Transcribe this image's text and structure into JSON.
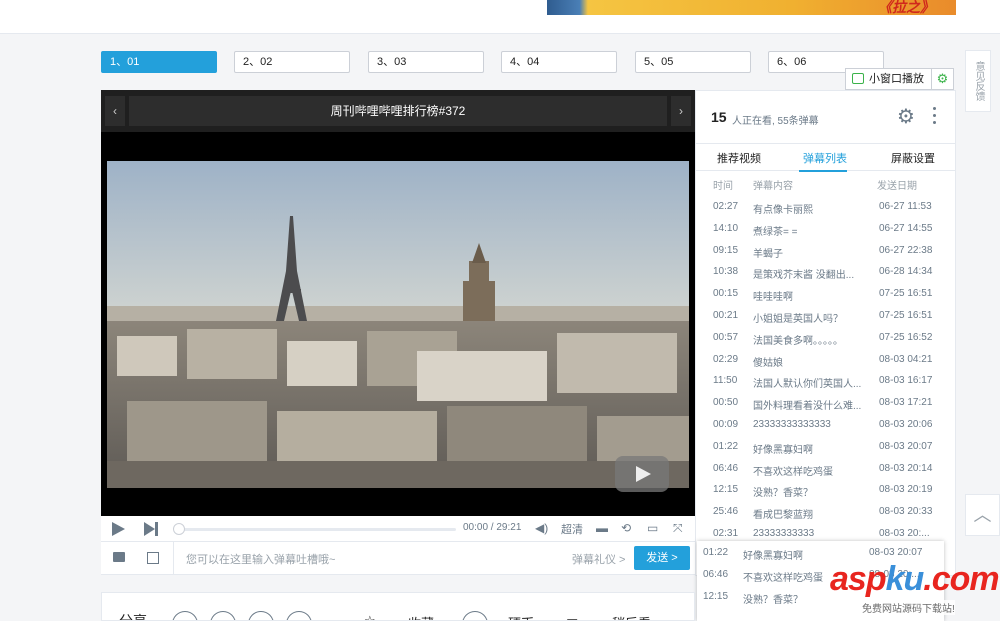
{
  "episodes": [
    "1、01",
    "2、02",
    "3、03",
    "4、04",
    "5、05",
    "6、06"
  ],
  "active_episode_index": 0,
  "feedback_label": "意见反馈",
  "mini_window_label": "小窗口播放",
  "player": {
    "title": "周刊哔哩哔哩排行榜#372",
    "prev_arrow": "‹",
    "next_arrow": "›",
    "current_time": "00:00",
    "total_time": "29:21",
    "quality_label": "超清",
    "progress": 0.0
  },
  "danmaku_input": {
    "placeholder": "您可以在这里输入弹幕吐槽哦~",
    "gift_label": "弹幕礼仪 >",
    "send_label": "发送 >"
  },
  "panel": {
    "viewer_count": "15",
    "watching_text": "人正在看, 55条弹幕",
    "tabs": [
      "推荐视频",
      "弹幕列表",
      "屏蔽设置"
    ],
    "active_tab_index": 1,
    "col_time": "时间",
    "col_content": "弹幕内容",
    "col_date": "发送日期",
    "rows": [
      {
        "time": "02:27",
        "content": "有点像卡丽熙",
        "date": "06-27 11:53"
      },
      {
        "time": "14:10",
        "content": "煮绿茶= =",
        "date": "06-27 14:55"
      },
      {
        "time": "09:15",
        "content": "羊蝎子",
        "date": "06-27 22:38"
      },
      {
        "time": "10:38",
        "content": "是策戏芥末酱 没翻出...",
        "date": "06-28 14:34"
      },
      {
        "time": "00:15",
        "content": "哇哇哇啊",
        "date": "07-25 16:51"
      },
      {
        "time": "00:21",
        "content": "小姐姐是英国人吗？",
        "date": "07-25 16:51"
      },
      {
        "time": "00:57",
        "content": "法国美食多啊。。。。。",
        "date": "07-25 16:52"
      },
      {
        "time": "02:29",
        "content": "傻姑娘",
        "date": "08-03 04:21"
      },
      {
        "time": "11:50",
        "content": "法国人默认你们英国人...",
        "date": "08-03 16:17"
      },
      {
        "time": "00:50",
        "content": "国外料理看着没什么难...",
        "date": "08-03 17:21"
      },
      {
        "time": "00:09",
        "content": "23333333333333",
        "date": "08-03 20:06"
      },
      {
        "time": "01:22",
        "content": "好像黑寡妇啊",
        "date": "08-03 20:07"
      },
      {
        "time": "06:46",
        "content": "不喜欢这样吃鸡蛋",
        "date": "08-03 20:14"
      },
      {
        "time": "12:15",
        "content": "没熟？香菜？",
        "date": "08-03 20:19"
      },
      {
        "time": "25:46",
        "content": "看成巴黎蓝翔",
        "date": "08-03 20:33"
      },
      {
        "time": "02:31",
        "content": "23333333333",
        "date": "08-03 20:..."
      }
    ]
  },
  "popup_rows": [
    {
      "time": "01:22",
      "content": "好像黑寡妇啊",
      "date": "08-03 20:07"
    },
    {
      "time": "06:46",
      "content": "不喜欢这样吃鸡蛋",
      "date": "08-03 20:..."
    },
    {
      "time": "12:15",
      "content": "没熟？香菜？",
      "date": ""
    }
  ],
  "share": {
    "label": "分享",
    "collect_label": "收藏",
    "coin_label": "硬币",
    "later_label": "稍后看"
  },
  "watermark": {
    "main_red": "asp",
    "main_blue": "ku",
    "main_tail": ".com",
    "sub": "免费网站源码下载站!"
  },
  "ad_text": "《拉之》"
}
